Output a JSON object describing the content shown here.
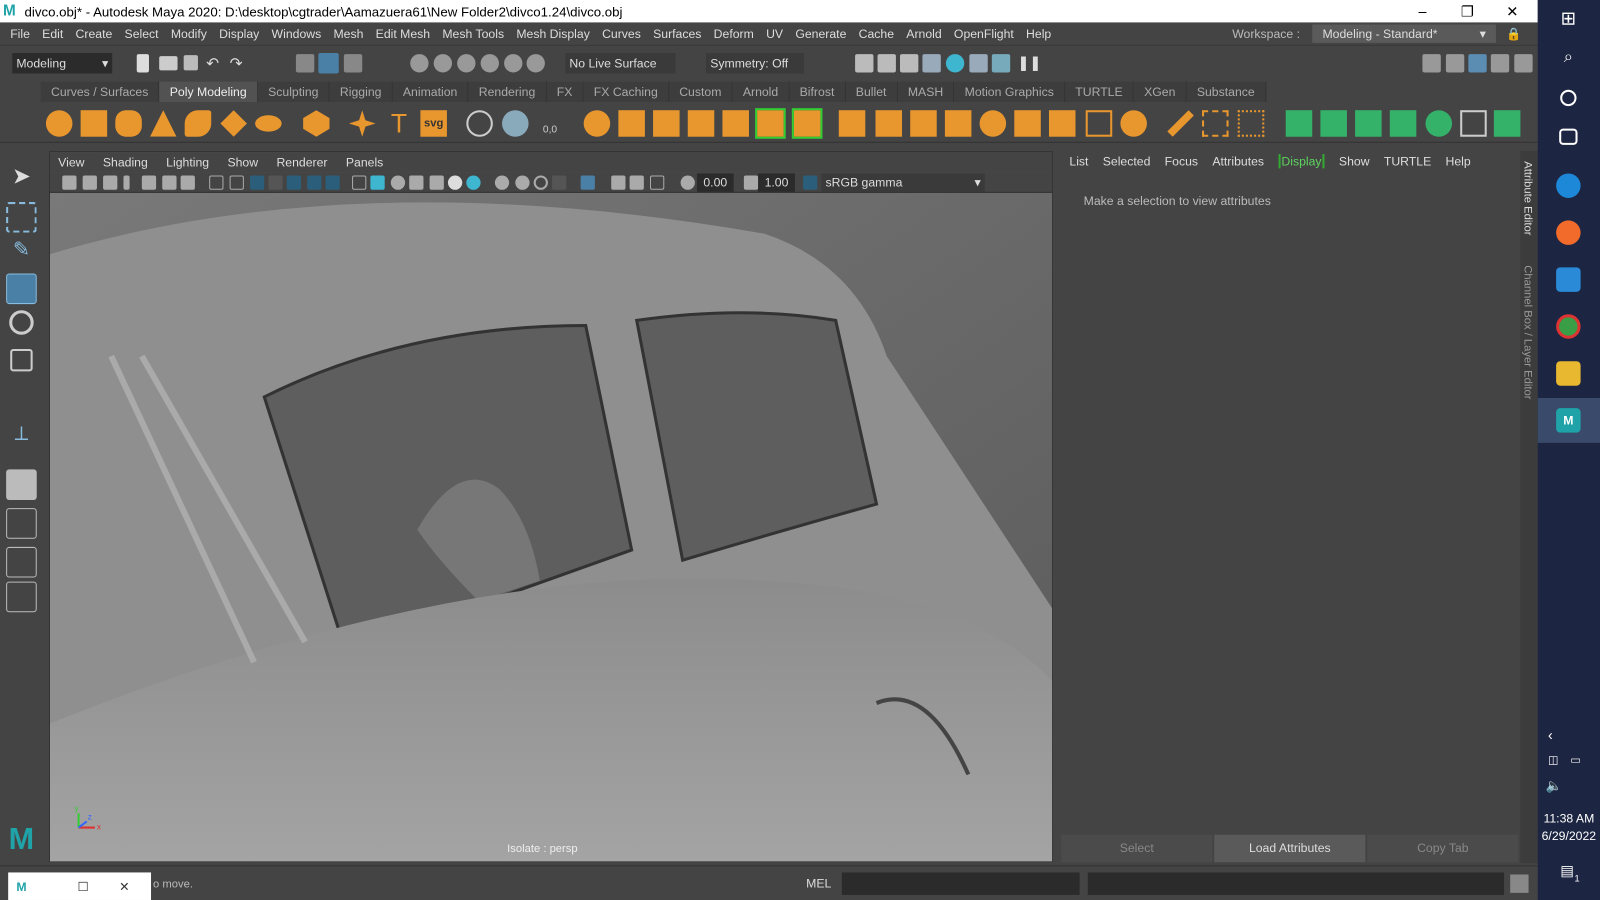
{
  "window": {
    "title": "divco.obj* - Autodesk Maya 2020: D:\\desktop\\cgtrader\\Aamazuera61\\New Folder2\\divco1.24\\divco.obj",
    "app_logo": "M",
    "minimize": "–",
    "restore": "❐",
    "close": "✕"
  },
  "menu": [
    "File",
    "Edit",
    "Create",
    "Select",
    "Modify",
    "Display",
    "Windows",
    "Mesh",
    "Edit Mesh",
    "Mesh Tools",
    "Mesh Display",
    "Curves",
    "Surfaces",
    "Deform",
    "UV",
    "Generate",
    "Cache",
    "Arnold",
    "OpenFlight",
    "Help"
  ],
  "workspace": {
    "label": "Workspace :",
    "value": "Modeling - Standard*"
  },
  "statusline": {
    "menuset": "Modeling",
    "live_surface": "No Live Surface",
    "symmetry": "Symmetry: Off"
  },
  "shelf_tabs": [
    "Curves / Surfaces",
    "Poly Modeling",
    "Sculpting",
    "Rigging",
    "Animation",
    "Rendering",
    "FX",
    "FX Caching",
    "Custom",
    "Arnold",
    "Bifrost",
    "Bullet",
    "MASH",
    "Motion Graphics",
    "TURTLE",
    "XGen",
    "Substance"
  ],
  "shelf_active": "Poly Modeling",
  "shelf_text_icons": {
    "type": "T",
    "svg": "svg",
    "uv": "0,0"
  },
  "viewport": {
    "menus": [
      "View",
      "Shading",
      "Lighting",
      "Show",
      "Renderer",
      "Panels"
    ],
    "exposure": "0.00",
    "gamma": "1.00",
    "color_space": "sRGB gamma",
    "hud": "Isolate : persp",
    "axis_x": "x",
    "axis_y": "y",
    "axis_z": "z"
  },
  "attribute_editor": {
    "menus": [
      "List",
      "Selected",
      "Focus",
      "Attributes",
      "Show",
      "TURTLE",
      "Help"
    ],
    "display_menu": "Display",
    "message": "Make a selection to view attributes",
    "buttons": {
      "select": "Select",
      "load": "Load Attributes",
      "copy": "Copy Tab"
    },
    "side_tabs": [
      "Attribute Editor",
      "Channel Box / Layer Editor"
    ]
  },
  "command": {
    "help_text": "o move.",
    "language": "MEL"
  },
  "taskbar": {
    "time": "11:38 AM",
    "date": "6/29/2022",
    "notifications": "1"
  },
  "colors": {
    "accent": "#5fd35f",
    "maya_teal": "#1fa3a8",
    "shelf_orange": "#e8962e",
    "taskbar": "#1c2541"
  }
}
